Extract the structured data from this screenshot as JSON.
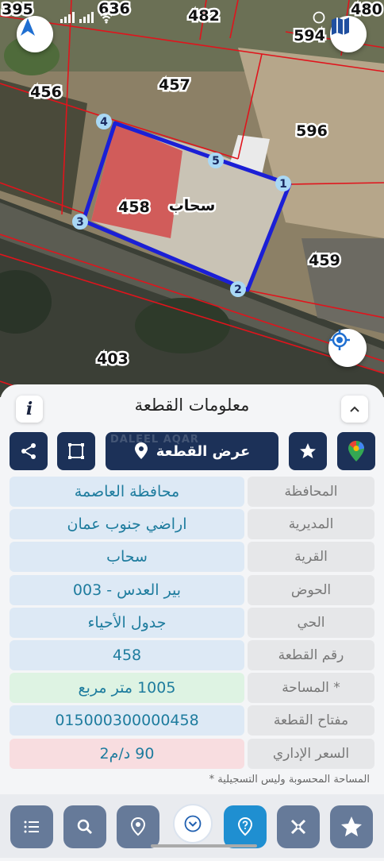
{
  "status_bar": {
    "time": ""
  },
  "map": {
    "parcel_labels": [
      {
        "id": "p395",
        "text": "395"
      },
      {
        "id": "p636",
        "text": "636"
      },
      {
        "id": "p482",
        "text": "482"
      },
      {
        "id": "p480",
        "text": "480"
      },
      {
        "id": "p594",
        "text": "594"
      },
      {
        "id": "p456",
        "text": "456"
      },
      {
        "id": "p457",
        "text": "457"
      },
      {
        "id": "p596",
        "text": "596"
      },
      {
        "id": "p458",
        "text": "458"
      },
      {
        "id": "p459",
        "text": "459"
      },
      {
        "id": "p403",
        "text": "403"
      }
    ],
    "village_label": "سحاب",
    "vertices": [
      "1",
      "2",
      "3",
      "4",
      "5"
    ]
  },
  "panel": {
    "title": "معلومات القطعة",
    "show_plot_label": "عرض القطعة",
    "watermark": "DALEEL AQAR",
    "rows": [
      {
        "label": "المحافظة",
        "value": "محافظة العاصمة",
        "bg": "#dde9f5"
      },
      {
        "label": "المديرية",
        "value": "اراضي جنوب عمان",
        "bg": "#dde9f5"
      },
      {
        "label": "القرية",
        "value": "سحاب",
        "bg": "#dde9f5"
      },
      {
        "label": "الحوض",
        "value": "بير العدس - 003",
        "bg": "#dde9f5"
      },
      {
        "label": "الحي",
        "value": "جدول الأحياء",
        "bg": "#dde9f5"
      },
      {
        "label": "رقم القطعة",
        "value": "458",
        "bg": "#dde9f5"
      },
      {
        "label": "المساحة *",
        "value": "1005   متر مربع",
        "bg": "#def3e3"
      },
      {
        "label": "مفتاح القطعة",
        "value": "015000300000458",
        "bg": "#dde9f5"
      },
      {
        "label": "السعر الإداري",
        "value": "90 د/م2",
        "bg": "#f8dde0"
      }
    ],
    "footnote": "* المساحة المحسوبة وليس التسجيلية"
  },
  "colors": {
    "dark_navy": "#1c3158",
    "accent_blue": "#1f8fd1",
    "parcel_outline": "#1b1fd6",
    "boundary_red": "#e0141c"
  }
}
